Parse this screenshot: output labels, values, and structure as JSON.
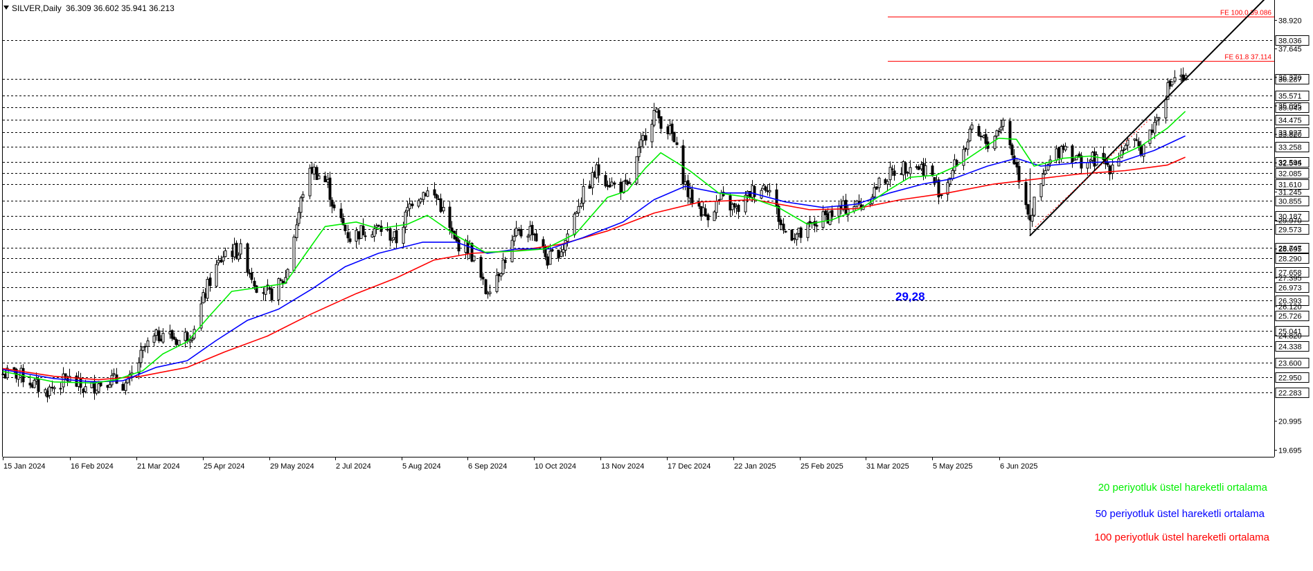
{
  "header": {
    "symbol_line": "SILVER,Daily",
    "ohlc": "36.309 36.602 35.941 36.213"
  },
  "colors": {
    "background": "#ffffff",
    "candle": "#000000",
    "grid": "#000000",
    "fib": "#ff0000",
    "ema20": "#00ee00",
    "ema50": "#0000ff",
    "ema100": "#ff0000",
    "trend": "#000000",
    "low_label": "#0000ff"
  },
  "chart_data": {
    "type": "candlestick",
    "instrument": "SILVER",
    "timeframe": "Daily",
    "ylim": [
      19.4,
      39.8
    ],
    "x_tick_labels": [
      "15 Jan 2024",
      "16 Feb 2024",
      "21 Mar 2024",
      "25 Apr 2024",
      "29 May 2024",
      "2 Jul 2024",
      "5 Aug 2024",
      "6 Sep 2024",
      "10 Oct 2024",
      "13 Nov 2024",
      "17 Dec 2024",
      "22 Jan 2025",
      "25 Feb 2025",
      "31 Mar 2025",
      "5 May 2025",
      "6 Jun 2025"
    ],
    "y_scale_labels": [
      "38.920",
      "37.645",
      "36.370",
      "35.095",
      "33.820",
      "32.545",
      "31.245",
      "29.970",
      "28.695",
      "27.395",
      "26.120",
      "24.820",
      "20.995",
      "19.695"
    ],
    "horizontal_levels": [
      "38.036",
      "36.287",
      "35.571",
      "35.043",
      "34.475",
      "33.927",
      "33.258",
      "32.594",
      "32.085",
      "31.610",
      "30.855",
      "30.187",
      "29.573",
      "28.747",
      "28.290",
      "27.658",
      "26.973",
      "26.393",
      "25.726",
      "25.041",
      "24.338",
      "23.600",
      "22.950",
      "22.283"
    ],
    "fib_levels": [
      {
        "label": "FE 100.0 39.086",
        "value": 39.086
      },
      {
        "label": "FE 61.8 37.114",
        "value": 37.114
      }
    ],
    "annotation_low": {
      "label": "29,28",
      "value": 29.28,
      "date": "2025-04-09"
    },
    "trendline": {
      "from": {
        "date": "2025-04-09",
        "value": 29.28
      },
      "to": {
        "date": "2025-07-25",
        "value": 40.0
      }
    },
    "ema_legend": [
      {
        "label": "20 periyotluk üstel hareketli ortalama",
        "color": "#00ee00"
      },
      {
        "label": "50 periyotluk üstel hareketli ortalama",
        "color": "#0000ff"
      },
      {
        "label": "100 periyotluk üstel hareketli ortalama",
        "color": "#ff0000"
      }
    ],
    "price_path": [
      [
        "2024-01-10",
        23.1
      ],
      [
        "2024-01-22",
        22.3
      ],
      [
        "2024-02-01",
        22.9
      ],
      [
        "2024-02-09",
        22.4
      ],
      [
        "2024-02-20",
        22.9
      ],
      [
        "2024-02-28",
        22.6
      ],
      [
        "2024-03-07",
        24.3
      ],
      [
        "2024-03-15",
        25.0
      ],
      [
        "2024-03-22",
        24.6
      ],
      [
        "2024-03-28",
        25.0
      ],
      [
        "2024-04-05",
        27.3
      ],
      [
        "2024-04-12",
        28.6
      ],
      [
        "2024-04-19",
        28.6
      ],
      [
        "2024-04-26",
        27.1
      ],
      [
        "2024-05-02",
        26.6
      ],
      [
        "2024-05-09",
        27.4
      ],
      [
        "2024-05-17",
        31.3
      ],
      [
        "2024-05-21",
        32.3
      ],
      [
        "2024-05-28",
        31.6
      ],
      [
        "2024-05-31",
        30.4
      ],
      [
        "2024-06-07",
        29.2
      ],
      [
        "2024-06-14",
        29.6
      ],
      [
        "2024-06-21",
        29.6
      ],
      [
        "2024-06-28",
        29.1
      ],
      [
        "2024-07-05",
        30.9
      ],
      [
        "2024-07-11",
        31.3
      ],
      [
        "2024-07-17",
        30.9
      ],
      [
        "2024-07-24",
        29.0
      ],
      [
        "2024-07-31",
        28.7
      ],
      [
        "2024-08-07",
        26.8
      ],
      [
        "2024-08-14",
        27.9
      ],
      [
        "2024-08-21",
        29.3
      ],
      [
        "2024-08-28",
        29.6
      ],
      [
        "2024-09-04",
        28.2
      ],
      [
        "2024-09-11",
        28.8
      ],
      [
        "2024-09-18",
        30.8
      ],
      [
        "2024-09-26",
        32.2
      ],
      [
        "2024-10-03",
        31.6
      ],
      [
        "2024-10-10",
        31.4
      ],
      [
        "2024-10-18",
        33.9
      ],
      [
        "2024-10-22",
        34.8
      ],
      [
        "2024-10-30",
        33.8
      ],
      [
        "2024-11-06",
        31.2
      ],
      [
        "2024-11-14",
        30.2
      ],
      [
        "2024-11-21",
        30.9
      ],
      [
        "2024-11-28",
        30.4
      ],
      [
        "2024-12-05",
        31.3
      ],
      [
        "2024-12-12",
        31.6
      ],
      [
        "2024-12-19",
        29.5
      ],
      [
        "2024-12-27",
        29.3
      ],
      [
        "2025-01-03",
        29.9
      ],
      [
        "2025-01-10",
        30.3
      ],
      [
        "2025-01-17",
        30.6
      ],
      [
        "2025-01-24",
        30.7
      ],
      [
        "2025-01-31",
        31.6
      ],
      [
        "2025-02-07",
        32.2
      ],
      [
        "2025-02-14",
        32.5
      ],
      [
        "2025-02-21",
        32.3
      ],
      [
        "2025-02-28",
        31.2
      ],
      [
        "2025-03-07",
        32.6
      ],
      [
        "2025-03-14",
        33.9
      ],
      [
        "2025-03-21",
        33.4
      ],
      [
        "2025-03-28",
        34.4
      ],
      [
        "2025-04-03",
        32.3
      ],
      [
        "2025-04-09",
        30.1
      ],
      [
        "2025-04-17",
        32.4
      ],
      [
        "2025-04-24",
        33.4
      ],
      [
        "2025-05-01",
        32.6
      ],
      [
        "2025-05-08",
        32.7
      ],
      [
        "2025-05-15",
        32.4
      ],
      [
        "2025-05-22",
        33.4
      ],
      [
        "2025-05-29",
        33.2
      ],
      [
        "2025-06-04",
        34.3
      ],
      [
        "2025-06-09",
        35.7
      ],
      [
        "2025-06-13",
        36.4
      ],
      [
        "2025-06-18",
        36.2
      ]
    ],
    "ema20_path": [
      [
        "2024-01-03",
        23.22
      ],
      [
        "2024-01-26",
        22.75
      ],
      [
        "2024-02-13",
        22.7
      ],
      [
        "2024-02-23",
        22.85
      ],
      [
        "2024-03-06",
        23.25
      ],
      [
        "2024-03-15",
        24.0
      ],
      [
        "2024-03-26",
        24.55
      ],
      [
        "2024-04-05",
        25.7
      ],
      [
        "2024-04-15",
        26.8
      ],
      [
        "2024-04-29",
        27.0
      ],
      [
        "2024-05-09",
        27.15
      ],
      [
        "2024-05-17",
        28.3
      ],
      [
        "2024-05-27",
        29.7
      ],
      [
        "2024-06-10",
        29.9
      ],
      [
        "2024-06-20",
        29.6
      ],
      [
        "2024-07-03",
        29.8
      ],
      [
        "2024-07-12",
        30.2
      ],
      [
        "2024-07-25",
        29.3
      ],
      [
        "2024-08-07",
        28.55
      ],
      [
        "2024-08-21",
        28.6
      ],
      [
        "2024-09-03",
        28.7
      ],
      [
        "2024-09-17",
        29.4
      ],
      [
        "2024-10-01",
        31.0
      ],
      [
        "2024-10-10",
        31.3
      ],
      [
        "2024-10-18",
        32.3
      ],
      [
        "2024-10-25",
        33.0
      ],
      [
        "2024-11-07",
        32.2
      ],
      [
        "2024-11-20",
        31.2
      ],
      [
        "2024-12-04",
        31.0
      ],
      [
        "2024-12-17",
        30.55
      ],
      [
        "2024-12-30",
        29.8
      ],
      [
        "2025-01-10",
        30.0
      ],
      [
        "2025-01-23",
        30.5
      ],
      [
        "2025-02-04",
        31.3
      ],
      [
        "2025-02-14",
        31.9
      ],
      [
        "2025-02-26",
        32.0
      ],
      [
        "2025-03-07",
        32.4
      ],
      [
        "2025-03-19",
        33.2
      ],
      [
        "2025-03-26",
        33.65
      ],
      [
        "2025-04-03",
        33.6
      ],
      [
        "2025-04-11",
        32.4
      ],
      [
        "2025-04-24",
        32.75
      ],
      [
        "2025-05-06",
        32.85
      ],
      [
        "2025-05-16",
        32.7
      ],
      [
        "2025-05-29",
        33.3
      ],
      [
        "2025-06-10",
        34.1
      ],
      [
        "2025-06-18",
        34.85
      ]
    ],
    "ema50_path": [
      [
        "2024-01-03",
        23.3
      ],
      [
        "2024-01-26",
        22.9
      ],
      [
        "2024-02-13",
        22.75
      ],
      [
        "2024-02-26",
        22.8
      ],
      [
        "2024-03-12",
        23.4
      ],
      [
        "2024-03-26",
        23.7
      ],
      [
        "2024-04-08",
        24.6
      ],
      [
        "2024-04-22",
        25.5
      ],
      [
        "2024-05-06",
        26.0
      ],
      [
        "2024-05-21",
        26.9
      ],
      [
        "2024-06-05",
        27.9
      ],
      [
        "2024-06-20",
        28.5
      ],
      [
        "2024-07-10",
        29.0
      ],
      [
        "2024-07-25",
        29.0
      ],
      [
        "2024-08-08",
        28.5
      ],
      [
        "2024-08-22",
        28.7
      ],
      [
        "2024-09-05",
        28.7
      ],
      [
        "2024-09-20",
        29.2
      ],
      [
        "2024-10-08",
        29.9
      ],
      [
        "2024-10-22",
        30.9
      ],
      [
        "2024-11-05",
        31.5
      ],
      [
        "2024-11-20",
        31.2
      ],
      [
        "2024-12-05",
        31.2
      ],
      [
        "2024-12-20",
        30.8
      ],
      [
        "2025-01-06",
        30.55
      ],
      [
        "2025-01-21",
        30.7
      ],
      [
        "2025-02-05",
        31.2
      ],
      [
        "2025-02-20",
        31.6
      ],
      [
        "2025-03-06",
        31.85
      ],
      [
        "2025-03-21",
        32.4
      ],
      [
        "2025-04-03",
        32.75
      ],
      [
        "2025-04-14",
        32.4
      ],
      [
        "2025-05-01",
        32.55
      ],
      [
        "2025-05-20",
        32.6
      ],
      [
        "2025-06-04",
        33.1
      ],
      [
        "2025-06-18",
        33.75
      ]
    ],
    "ema100_path": [
      [
        "2024-01-03",
        23.35
      ],
      [
        "2024-01-26",
        23.0
      ],
      [
        "2024-02-15",
        22.85
      ],
      [
        "2024-03-05",
        23.0
      ],
      [
        "2024-03-26",
        23.4
      ],
      [
        "2024-04-12",
        24.1
      ],
      [
        "2024-05-01",
        24.8
      ],
      [
        "2024-05-21",
        25.8
      ],
      [
        "2024-06-10",
        26.7
      ],
      [
        "2024-06-28",
        27.4
      ],
      [
        "2024-07-15",
        28.2
      ],
      [
        "2024-08-01",
        28.5
      ],
      [
        "2024-08-20",
        28.6
      ],
      [
        "2024-09-10",
        28.9
      ],
      [
        "2024-10-01",
        29.5
      ],
      [
        "2024-10-22",
        30.3
      ],
      [
        "2024-11-12",
        30.8
      ],
      [
        "2024-12-06",
        30.9
      ],
      [
        "2024-12-31",
        30.45
      ],
      [
        "2025-01-21",
        30.5
      ],
      [
        "2025-02-10",
        30.9
      ],
      [
        "2025-03-03",
        31.2
      ],
      [
        "2025-03-24",
        31.6
      ],
      [
        "2025-04-10",
        31.8
      ],
      [
        "2025-05-01",
        32.05
      ],
      [
        "2025-05-22",
        32.2
      ],
      [
        "2025-06-10",
        32.45
      ],
      [
        "2025-06-18",
        32.8
      ]
    ]
  }
}
